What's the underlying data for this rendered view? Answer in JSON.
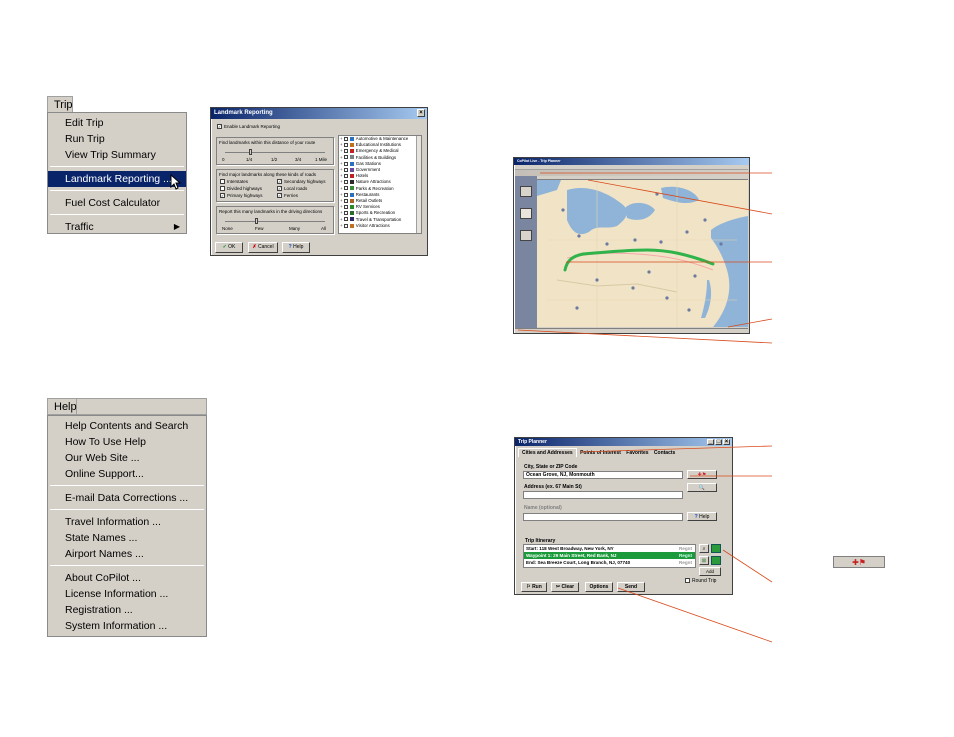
{
  "trip_menu": {
    "tab": "Trip",
    "items": [
      "Edit Trip",
      "Run Trip",
      "View Trip Summary",
      "Landmark Reporting ...",
      "Fuel Cost Calculator",
      "Traffic"
    ]
  },
  "help_menu": {
    "tab": "Help",
    "items": [
      "Help Contents and Search",
      "How To Use Help",
      "Our Web Site ...",
      "Online Support...",
      "E-mail Data Corrections ...",
      "Travel Information ...",
      "State Names ...",
      "Airport Names ...",
      "About CoPilot ...",
      "License Information ...",
      "Registration ...",
      "System Information ..."
    ]
  },
  "landmark_dialog": {
    "title": "Landmark Reporting",
    "enable_label": "Enable Landmark Reporting",
    "distance_label": "Find landmarks within this distance of your route",
    "distance_ticks": [
      "0",
      "1/4",
      "1/2",
      "3/4",
      "1 Mile"
    ],
    "roads_label": "Find major landmarks along these kinds of roads",
    "roads": [
      {
        "label": "Interstates",
        "checked": false
      },
      {
        "label": "Secondary highways",
        "checked": true
      },
      {
        "label": "Divided highways",
        "checked": false
      },
      {
        "label": "Local roads",
        "checked": true
      },
      {
        "label": "Primary highways",
        "checked": true
      },
      {
        "label": "Ferries",
        "checked": true
      }
    ],
    "report_label": "Report this many landmarks in the driving directions",
    "report_ticks": [
      "None",
      "Few",
      "Many",
      "All"
    ],
    "categories": [
      "Automotive & Maintenance",
      "Educational Institutions",
      "Emergency & Medical",
      "Facilities & Buildings",
      "Gas Stations",
      "Government",
      "Hotels",
      "Nature Attractions",
      "Parks & Recreation",
      "Restaurants",
      "Retail Outlets",
      "RV Services",
      "Sports & Recreation",
      "Travel & Transportation",
      "Visitor Attractions"
    ],
    "ok": "OK",
    "cancel": "Cancel",
    "help": "Help"
  },
  "trip_planner": {
    "title": "Trip Planner",
    "tabs": [
      "Cities and Addresses",
      "Points of Interest",
      "Favorites",
      "Contacts"
    ],
    "city_label": "City, State or ZIP Code",
    "city_value": "Ocean Grove, NJ, Monmouth",
    "address_label": "Address (ex. 67 Main St)",
    "name_label": "Name (optional)",
    "help": "Help",
    "itinerary_label": "Trip Itinerary",
    "itinerary": [
      {
        "text": "Start: 118 West Broadway, New York, NY",
        "tag": "Regnt"
      },
      {
        "text": "Waypoint 1: 29 Main Street, Red Bank, NJ",
        "tag": "Regnt"
      },
      {
        "text": "End: Sea Breeze Court, Long Branch, NJ, 07740",
        "tag": "Regnt"
      }
    ],
    "add_label": "Add",
    "round_trip": "Round Trip",
    "buttons": [
      "Run",
      "Clear",
      "Options",
      "Send"
    ]
  },
  "map_window": {
    "title": "CoPilot Live - Trip Planner"
  },
  "colors": {
    "menu_bg": "#d4d0c8",
    "selection": "#0a246a",
    "callout": "#d84a1b",
    "map_land": "#f1e4c6",
    "map_water": "#8fb4d8",
    "route": "#2fb34a"
  }
}
